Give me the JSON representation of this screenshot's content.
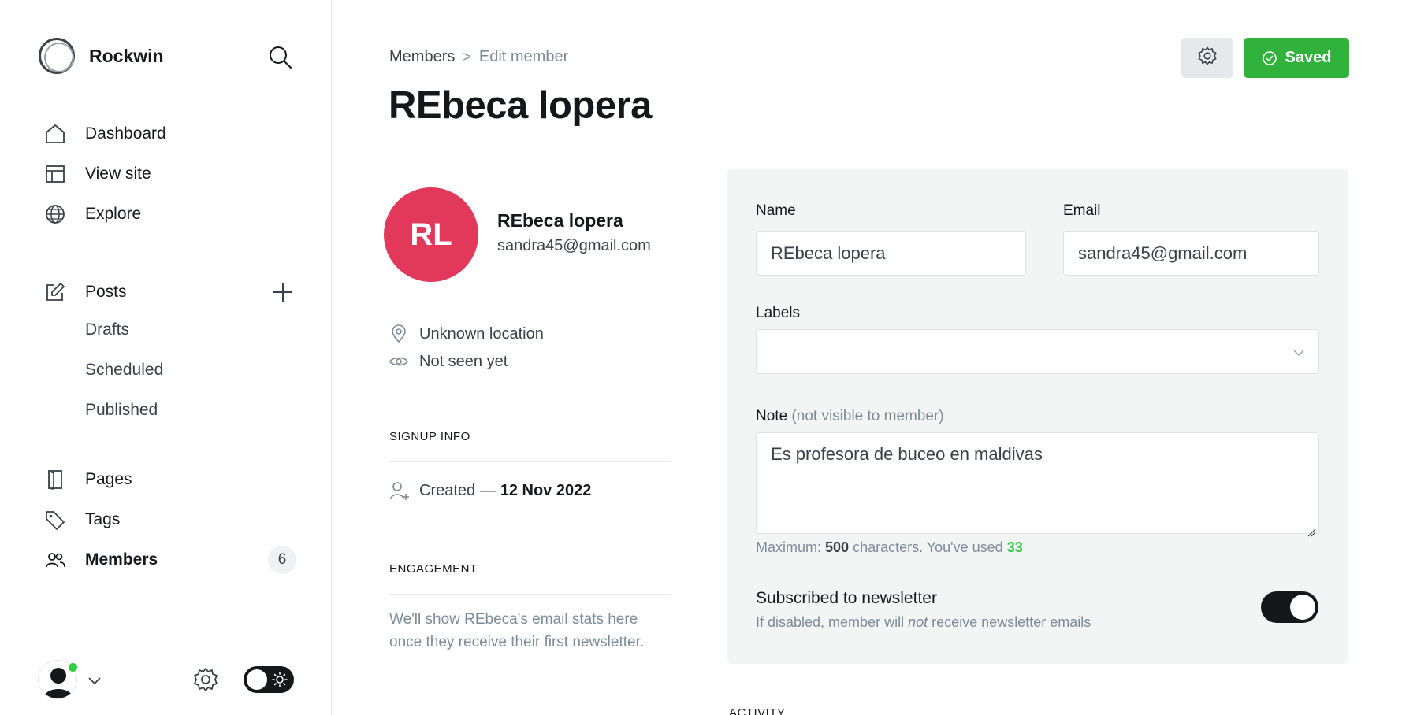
{
  "sidebar": {
    "brand": "Rockwin",
    "nav": {
      "dashboard": "Dashboard",
      "view_site": "View site",
      "explore": "Explore",
      "posts": "Posts",
      "drafts": "Drafts",
      "scheduled": "Scheduled",
      "published": "Published",
      "pages": "Pages",
      "tags": "Tags",
      "members": "Members"
    },
    "members_count": "6"
  },
  "header": {
    "breadcrumb_parent": "Members",
    "breadcrumb_separator": ">",
    "breadcrumb_current": "Edit member",
    "title": "REbeca lopera",
    "saved_label": "Saved"
  },
  "profile": {
    "initials": "RL",
    "name": "REbeca lopera",
    "email": "sandra45@gmail.com",
    "location": "Unknown location",
    "last_seen": "Not seen yet",
    "signup_heading": "SIGNUP INFO",
    "created_label": "Created —",
    "created_date": "12 Nov 2022",
    "engagement_heading": "ENGAGEMENT",
    "engagement_text": "We'll show REbeca's email stats here once they receive their first newsletter."
  },
  "form": {
    "name_label": "Name",
    "name_value": "REbeca lopera",
    "email_label": "Email",
    "email_value": "sandra45@gmail.com",
    "labels_label": "Labels",
    "labels_value": "",
    "note_label": "Note",
    "note_hint": "(not visible to member)",
    "note_value": "Es profesora de buceo en maldivas",
    "limit_prefix": "Maximum:",
    "limit_max": "500",
    "limit_middle": "characters. You've used",
    "limit_used": "33",
    "newsletter_label": "Subscribed to newsletter",
    "newsletter_desc_prefix": "If disabled, member will",
    "newsletter_desc_em": "not",
    "newsletter_desc_suffix": "receive newsletter emails",
    "newsletter_subscribed": true
  },
  "activity_heading": "ACTIVITY",
  "colors": {
    "accent_green": "#30b23c",
    "avatar_bg": "#e23859",
    "online": "#30cf43"
  }
}
